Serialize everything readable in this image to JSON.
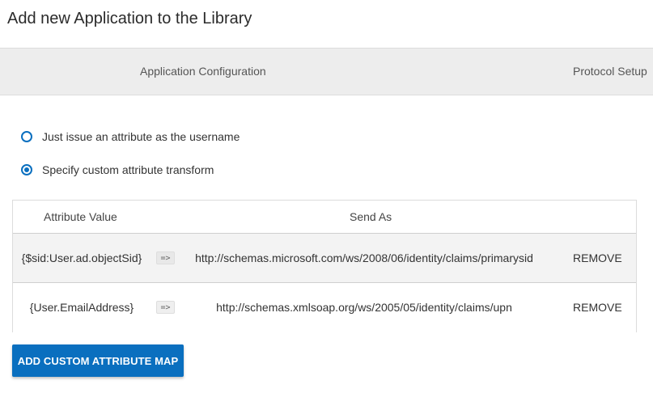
{
  "page": {
    "title": "Add new Application to the Library"
  },
  "steps": [
    {
      "label": "Application Configuration"
    },
    {
      "label": "Protocol Setup"
    }
  ],
  "options": [
    {
      "label": "Just issue an attribute as the username",
      "selected": false
    },
    {
      "label": "Specify custom attribute transform",
      "selected": true
    }
  ],
  "table": {
    "headers": {
      "attribute": "Attribute Value",
      "send_as": "Send As"
    },
    "rows": [
      {
        "attribute": "{$sid:User.ad.objectSid}",
        "arrow": "=>",
        "send_as": "http://schemas.microsoft.com/ws/2008/06/identity/claims/primarysid",
        "action": "REMOVE"
      },
      {
        "attribute": "{User.EmailAddress}",
        "arrow": "=>",
        "send_as": "http://schemas.xmlsoap.org/ws/2005/05/identity/claims/upn",
        "action": "REMOVE"
      }
    ]
  },
  "buttons": {
    "add_custom_attribute_map": "ADD CUSTOM ATTRIBUTE MAP"
  },
  "colors": {
    "accent": "#0a6fbf",
    "steps_bar": "#ededed",
    "row_alt": "#f3f3f3"
  }
}
